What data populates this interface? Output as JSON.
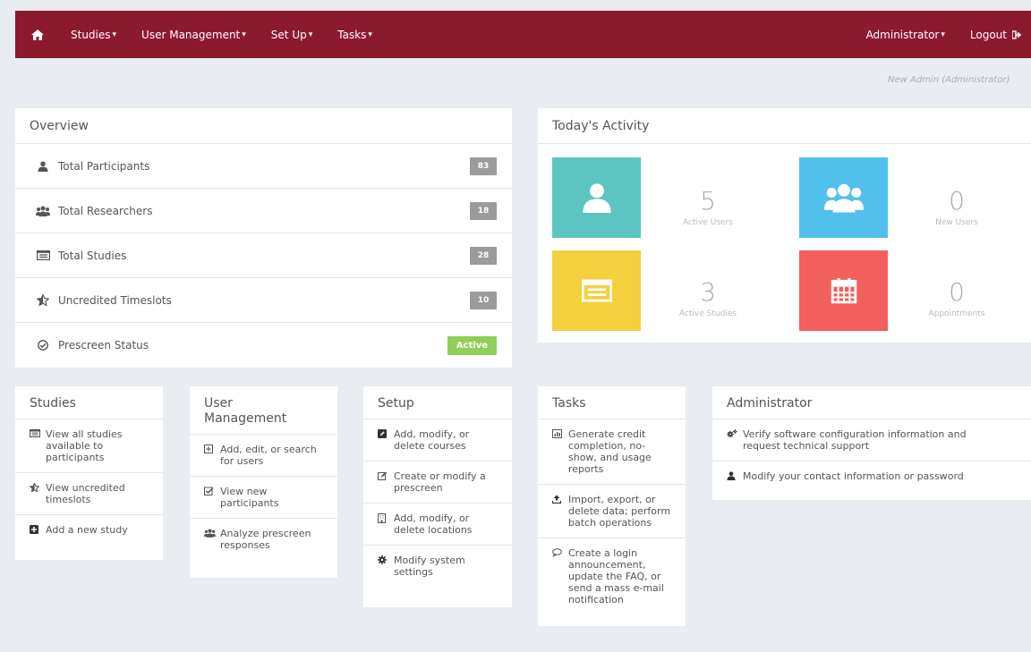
{
  "nav": {
    "home_icon": "home-icon",
    "items": [
      {
        "label": "Studies"
      },
      {
        "label": "User Management"
      },
      {
        "label": "Set Up"
      },
      {
        "label": "Tasks"
      }
    ],
    "admin_label": "Administrator",
    "logout_label": "Logout",
    "caret": "▾",
    "color": "#8c1a2f"
  },
  "user_line": "New Admin (Administrator)",
  "overview": {
    "title": "Overview",
    "rows": [
      {
        "label": "Total Participants",
        "value": "83",
        "icon": "user-icon"
      },
      {
        "label": "Total Researchers",
        "value": "18",
        "icon": "group-icon"
      },
      {
        "label": "Total Studies",
        "value": "28",
        "icon": "list-icon"
      },
      {
        "label": "Uncredited Timeslots",
        "value": "10",
        "icon": "star-half-icon"
      },
      {
        "label": "Prescreen Status",
        "value": "Active",
        "icon": "check-circle-icon"
      }
    ]
  },
  "activity": {
    "title": "Today's Activity",
    "stats": [
      {
        "value": "5",
        "label": "Active Users",
        "color": "#5cc5c1",
        "icon": "user-icon"
      },
      {
        "value": "0",
        "label": "New Users",
        "color": "#52c0ec",
        "icon": "group-icon"
      },
      {
        "value": "3",
        "label": "Active Studies",
        "color": "#f4d03f",
        "icon": "list-icon"
      },
      {
        "value": "0",
        "label": "Appointments",
        "color": "#f25f5c",
        "icon": "calendar-icon"
      }
    ]
  },
  "cards": {
    "studies": {
      "title": "Studies",
      "items": [
        "View all studies available to participants",
        "View uncredited timeslots",
        "Add a new study"
      ]
    },
    "user_management": {
      "title": "User Management",
      "items": [
        "Add, edit, or search for users",
        "View new participants",
        "Analyze prescreen responses"
      ]
    },
    "setup": {
      "title": "Setup",
      "items": [
        "Add, modify, or delete courses",
        "Create or modify a prescreen",
        "Add, modify, or delete locations",
        "Modify system settings"
      ]
    },
    "tasks": {
      "title": "Tasks",
      "items": [
        "Generate credit completion, no-show, and usage reports",
        "Import, export, or delete data; perform batch operations",
        "Create a login announcement, update the FAQ, or send a mass e-mail notification"
      ]
    },
    "administrator": {
      "title": "Administrator",
      "items": [
        "Verify software configuration information and request technical support",
        "Modify your contact information or password"
      ]
    }
  }
}
